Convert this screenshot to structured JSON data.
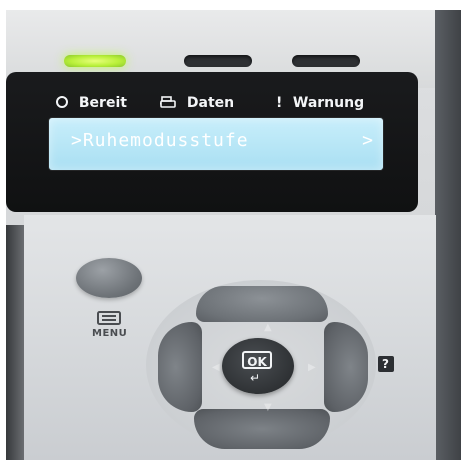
{
  "status_labels": {
    "ready": "Bereit",
    "data": "Daten",
    "warning": "Warnung"
  },
  "display": {
    "text": ">Ruhemodusstufe",
    "arrow": ">"
  },
  "buttons": {
    "menu_label": "MENU",
    "ok_label": "OK",
    "ok_enter_symbol": "↵",
    "help_label": "?"
  },
  "colors": {
    "ready_led": "#b9f03a",
    "lcd_background": "#b7e6f6",
    "panel_black": "#111214"
  }
}
